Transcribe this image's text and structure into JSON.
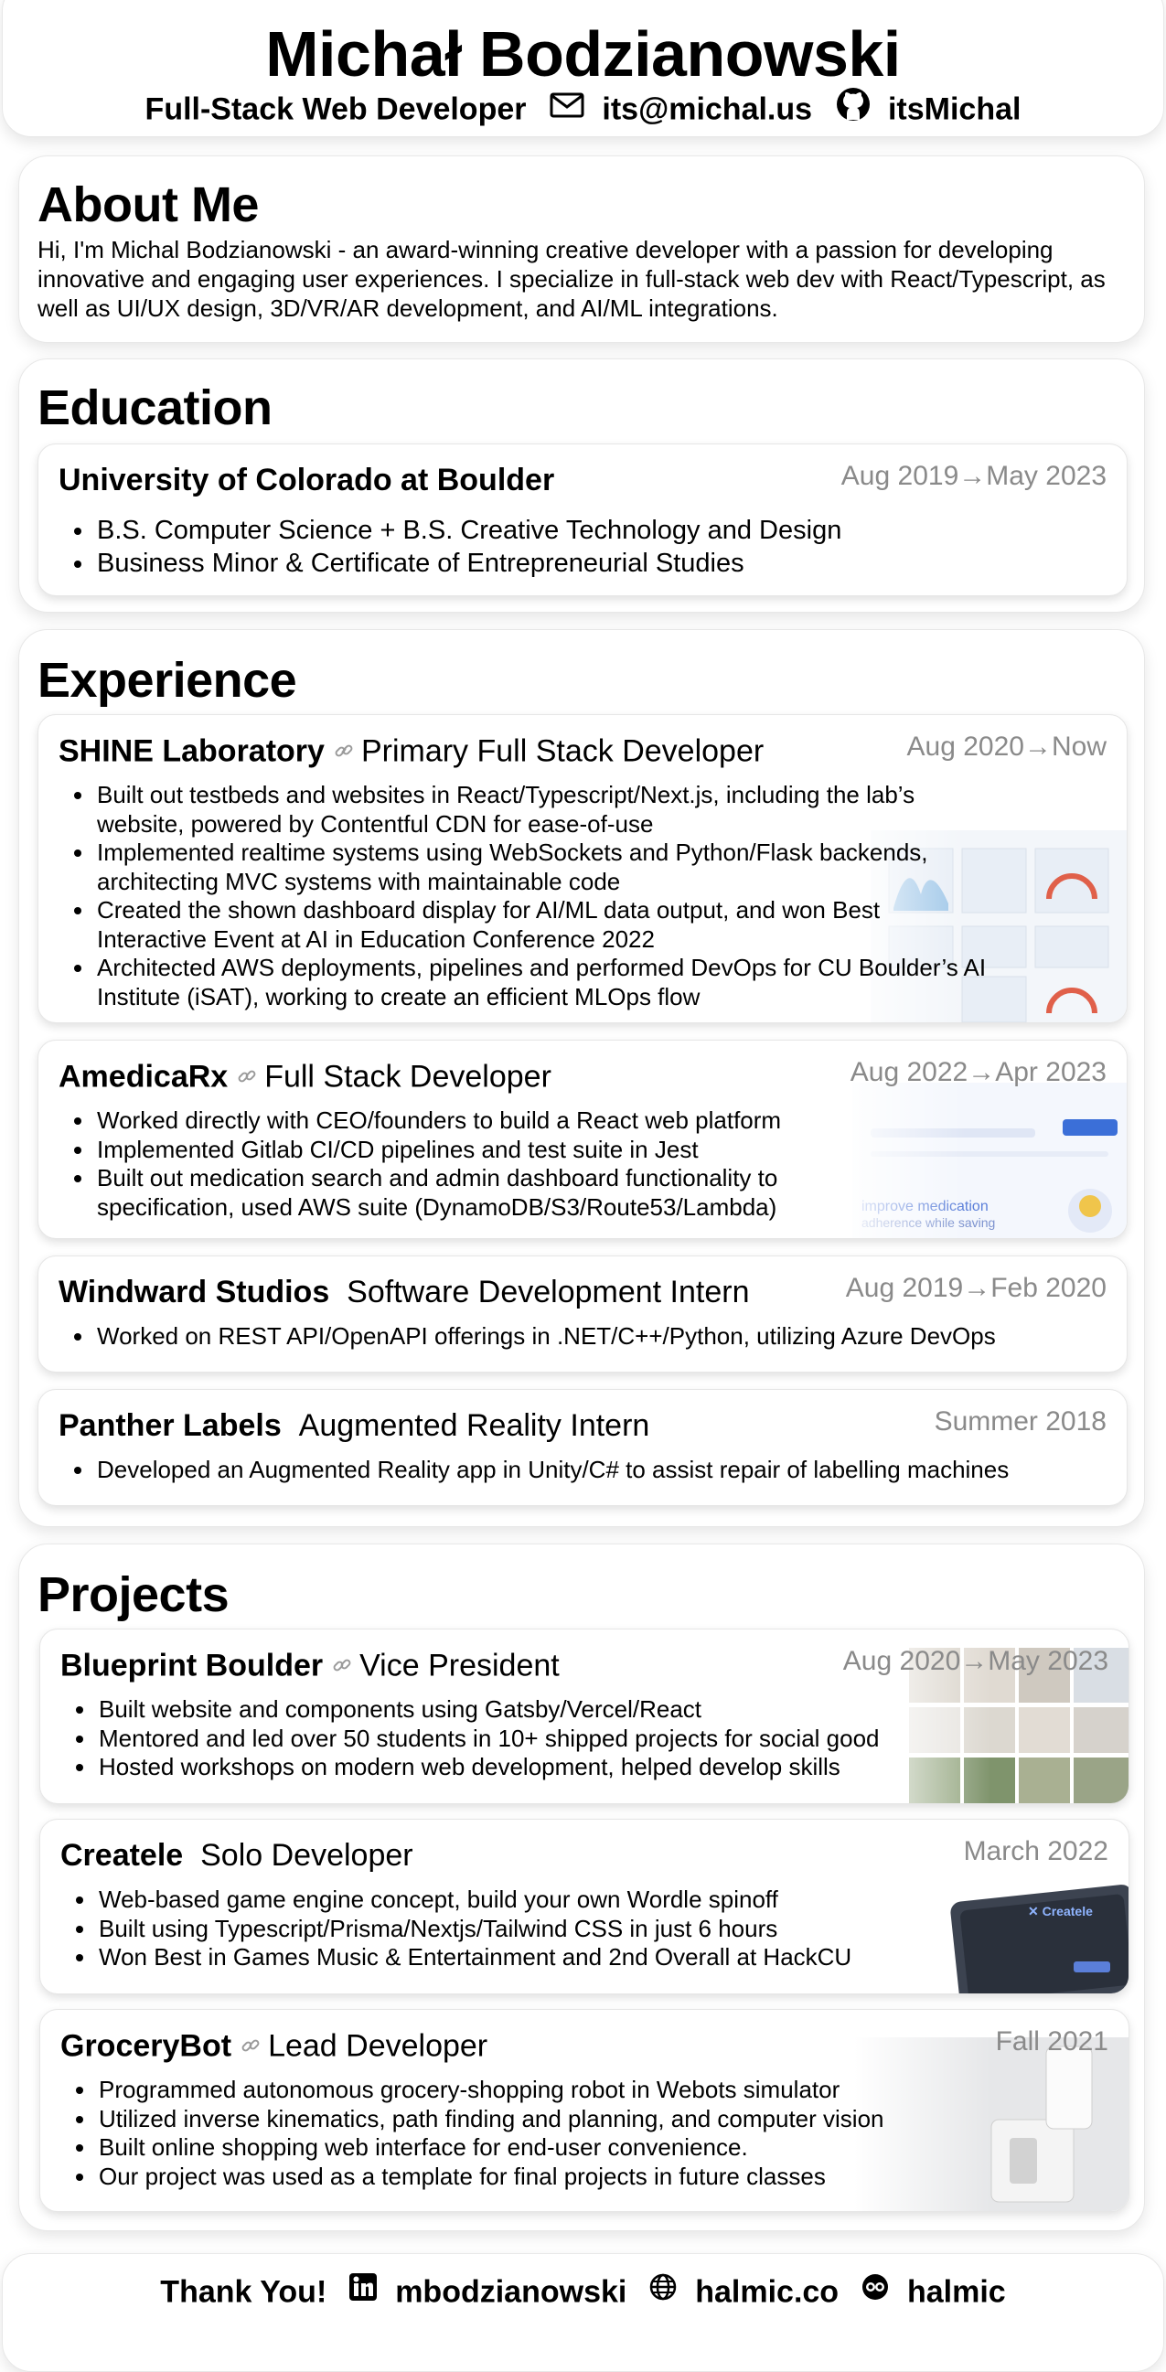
{
  "header": {
    "name": "Michał Bodzianowski",
    "title": "Full-Stack Web Developer",
    "email": "its@michal.us",
    "github": "itsMichal"
  },
  "about": {
    "heading": "About Me",
    "text": "Hi, I'm Michal Bodzianowski - an award-winning creative developer with a passion for developing innovative and engaging user experiences. I specialize in full-stack web dev with React/Typescript, as well as UI/UX design, 3D/VR/AR development, and AI/ML integrations."
  },
  "education": {
    "heading": "Education",
    "school": "University of Colorado at Boulder",
    "dates": "Aug 2019→May 2023",
    "bullets": [
      "B.S. Computer Science + B.S. Creative Technology and Design",
      "Business Minor & Certificate of Entrepreneurial Studies"
    ]
  },
  "experience": {
    "heading": "Experience",
    "items": [
      {
        "org": "SHINE Laboratory",
        "role": "Primary Full Stack Developer",
        "dates": "Aug 2020→Now",
        "bullets": [
          "Built out testbeds and websites in React/Typescript/Next.js, including the lab’s website, powered by Contentful CDN for ease-of-use",
          "Implemented realtime systems using WebSockets and Python/Flask backends, architecting MVC systems with maintainable code",
          "Created the shown dashboard display for AI/ML data output, and won Best Interactive Event at AI in Education Conference 2022",
          "Architected AWS deployments, pipelines and performed DevOps for CU Boulder’s AI Institute (iSAT), working to create an efficient MLOps flow"
        ]
      },
      {
        "org": "AmedicaRx",
        "role": "Full Stack Developer",
        "dates": "Aug 2022→Apr 2023",
        "bullets": [
          "Worked directly with CEO/founders to build a React web platform",
          "Implemented Gitlab CI/CD pipelines and test suite in Jest",
          "Built out medication search and admin dashboard functionality to specification, used AWS suite (DynamoDB/S3/Route53/Lambda)"
        ]
      },
      {
        "org": "Windward Studios",
        "role": "Software Development Intern",
        "dates": "Aug 2019→Feb 2020",
        "bullets": [
          "Worked on REST API/OpenAPI offerings in .NET/C++/Python, utilizing Azure DevOps"
        ]
      },
      {
        "org": "Panther Labels",
        "role": "Augmented Reality Intern",
        "dates": "Summer 2018",
        "bullets": [
          "Developed an Augmented Reality app in Unity/C# to assist repair of labelling machines"
        ]
      }
    ]
  },
  "projects": {
    "heading": "Projects",
    "items": [
      {
        "org": "Blueprint Boulder",
        "role": "Vice President",
        "dates": "Aug 2020→May 2023",
        "bullets": [
          "Built website and components using Gatsby/Vercel/React",
          "Mentored and led over 50 students in 10+ shipped projects for social good",
          "Hosted workshops on modern web development, helped develop skills"
        ]
      },
      {
        "org": "Createle",
        "role": "Solo Developer",
        "dates": "March 2022",
        "bullets": [
          "Web-based game engine concept, build your own Wordle spinoff",
          "Built using Typescript/Prisma/Nextjs/Tailwind CSS in just 6 hours",
          "Won Best in Games Music & Entertainment and 2nd Overall at HackCU"
        ]
      },
      {
        "org": "GroceryBot",
        "role": "Lead Developer",
        "dates": "Fall 2021",
        "bullets": [
          "Programmed autonomous grocery-shopping robot in Webots simulator",
          "Utilized inverse kinematics, path finding and planning, and computer vision",
          "Built online shopping web interface for end-user convenience.",
          "Our project was used as a template for final projects in future classes"
        ]
      }
    ]
  },
  "footer": {
    "thanks": "Thank You!",
    "linkedin": "mbodzianowski",
    "website": "halmic.co",
    "other": "halmic"
  },
  "icons": {
    "email": "envelope-icon",
    "github": "github-icon",
    "link": "link-icon",
    "linkedin": "linkedin-icon",
    "website": "globe-icon",
    "other": "glasses-icon"
  }
}
